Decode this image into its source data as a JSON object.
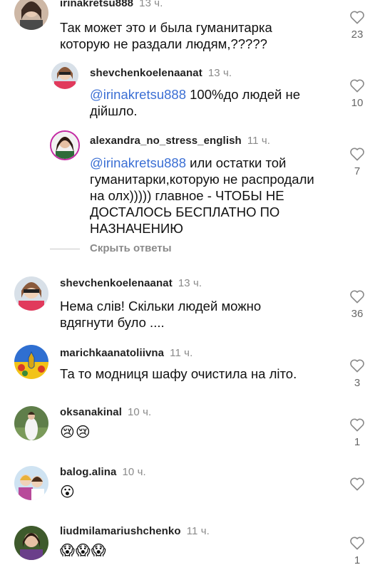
{
  "comments": [
    {
      "username": "irinakretsu888",
      "time": "13 ч.",
      "text": "Так может это и была гуманитарка которую не раздали людям,?????",
      "likes": "23"
    },
    {
      "username": "shevchenkoelenaanat",
      "time": "13 ч.",
      "mention": "@irinakretsu888",
      "text": " 100%до людей не дійшло.",
      "likes": "10"
    },
    {
      "username": "alexandra_no_stress_english",
      "time": "11 ч.",
      "mention": "@irinakretsu888",
      "text": " или остатки той гуманитарки,которую не распродали на олх))))) главное - ЧТОБЫ НЕ ДОСТАЛОСЬ БЕСПЛАТНО ПО НАЗНАЧЕНИЮ",
      "likes": "7"
    },
    {
      "username": "shevchenkoelenaanat",
      "time": "13 ч.",
      "text": "Нема слів! Скільки людей можно вдягнути було ....",
      "likes": "36"
    },
    {
      "username": "marichkaanatoliivna",
      "time": "11 ч.",
      "text": "Та то модниця шафу очистила на літо.",
      "likes": "3"
    },
    {
      "username": "oksanakinal",
      "time": "10 ч.",
      "text": "😢😢",
      "likes": "1"
    },
    {
      "username": "balog.alina",
      "time": "10 ч.",
      "text": "😮",
      "likes": ""
    },
    {
      "username": "liudmilamariushchenko",
      "time": "11 ч.",
      "text": "😱😱😱",
      "likes": "1"
    }
  ],
  "hide_replies_label": "Скрыть ответы",
  "colors": {
    "mention": "#3b6fd4",
    "secondary_text": "#8a8a8a",
    "accent_avatar_ring": "#c32aa3"
  },
  "icons": {
    "like": "heart-outline-icon"
  }
}
